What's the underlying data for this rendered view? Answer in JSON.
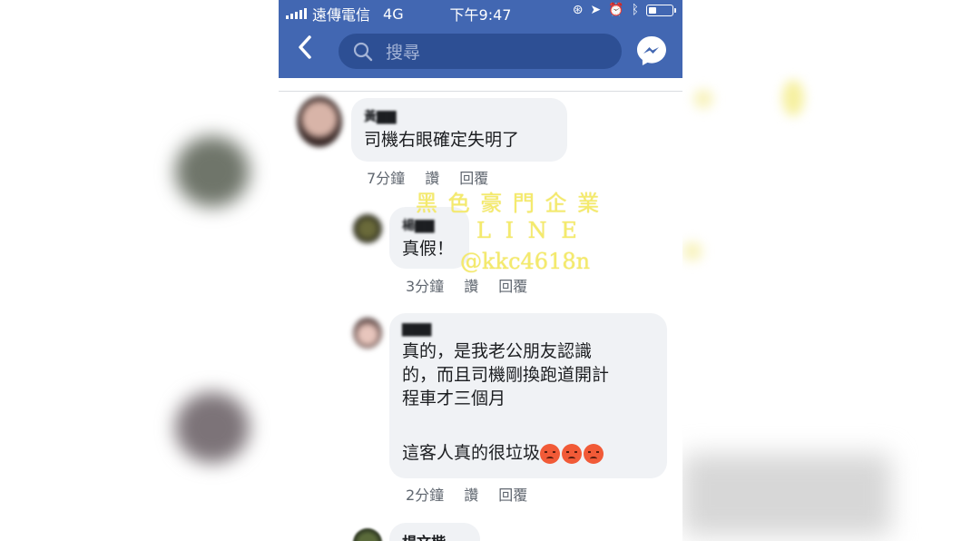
{
  "status_bar": {
    "carrier": "遠傳電信",
    "network": "4G",
    "time": "下午9:47"
  },
  "nav": {
    "back_icon": "chevron-left-icon",
    "search_placeholder": "搜尋",
    "messenger_icon": "messenger-icon"
  },
  "comments": [
    {
      "name": "黃▇▇",
      "text": "司機右眼確定失明了",
      "time": "7分鐘",
      "like": "讚",
      "reply": "回覆"
    },
    {
      "name": "楊▇▇",
      "text": "真假！",
      "time": "3分鐘",
      "like": "讚",
      "reply": "回覆"
    },
    {
      "name": "▇▇▇",
      "text": "真的，是我老公朋友認識\n的，而且司機剛換跑道開計\n程車才三個月",
      "text2": "這客人真的很垃圾",
      "time": "2分鐘",
      "like": "讚",
      "reply": "回覆"
    },
    {
      "name": "楊文楷"
    }
  ],
  "watermark": {
    "line1": "黑 色 豪 門 企 業",
    "line2": "L I N E",
    "line3": "@kkc4618n"
  },
  "colors": {
    "facebook_blue": "#4267b2",
    "bubble_gray": "#f0f2f5",
    "watermark_yellow": "#f4ea6c"
  }
}
